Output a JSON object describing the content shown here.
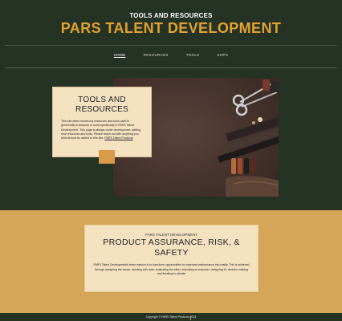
{
  "header": {
    "eyebrow": "TOOLS AND RESOURCES",
    "brand": "PARS TALENT DEVELOPMENT"
  },
  "nav": {
    "items": [
      {
        "label": "HOME",
        "active": true
      },
      {
        "label": "RESOURCES",
        "active": false
      },
      {
        "label": "TOOLS",
        "active": false
      },
      {
        "label": "SOPS",
        "active": false
      }
    ]
  },
  "hero": {
    "title_line1": "TOOLS AND",
    "title_line2": "RESOURCES",
    "text_main": "This site offers numerous resources and tools used in generically in Amazon or used specifically in PARS Talent Development. This page is always under development; adding new resources and tools. Please reach out with anything you think should be added to this site.",
    "link_label": "PARS Talent Products",
    "image_alt": "leather-crafting-tools-photo"
  },
  "band": {
    "eyebrow": "PARS TALENT DEVELOPMENT",
    "title": "PRODUCT ASSURANCE, RISK, & SAFETY",
    "text": "PARS Talent Development's team mission is to transform opportunities for improved performance into reality. This is achieved through analyzing the cause, deciding with data, evaluating the effort, educating to empower, designing for decision making and iterating to elevate"
  },
  "footer": {
    "copyright": "Copyright © PARS Talent Products 2023"
  },
  "colors": {
    "background": "#253325",
    "accent": "#e2a12c",
    "card": "#f3e1c0",
    "band": "#d5a658"
  }
}
